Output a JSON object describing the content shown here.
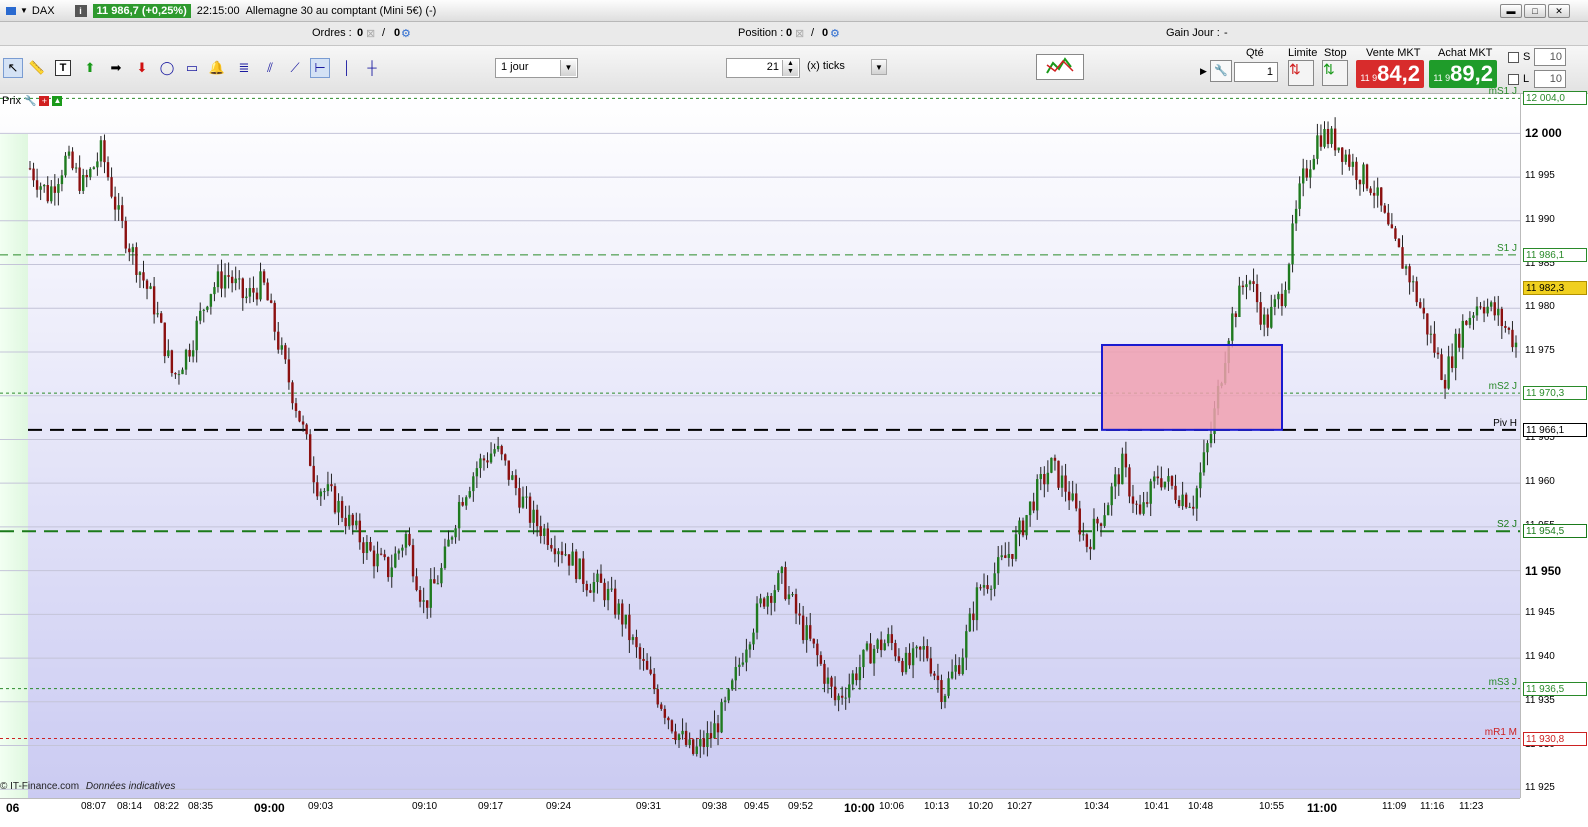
{
  "titlebar": {
    "symbol": "DAX",
    "info_icon": "i",
    "price_badge": "11 986,7 (+0,25%)",
    "time": "22:15:00",
    "instrument": "Allemagne 30 au comptant (Mini 5€) (-)"
  },
  "status": {
    "ordres_label": "Ordres :",
    "ordres_value": "0",
    "ordres_value2": "0",
    "position_label": "Position :",
    "position_value": "0",
    "position_value2": "0",
    "gain_label": "Gain Jour :",
    "gain_value": "-"
  },
  "toolbar": {
    "period": "1 jour",
    "ticks_value": "21",
    "ticks_unit": "(x) ticks"
  },
  "trade": {
    "qte_label": "Qté",
    "qte_value": "1",
    "limite_label": "Limite",
    "stop_label": "Stop",
    "vente_label": "Vente MKT",
    "vente_small": "11 9",
    "vente_big": "84,2",
    "achat_label": "Achat MKT",
    "achat_small": "11 9",
    "achat_big": "89,2",
    "s_label": "S",
    "s_value": "10",
    "l_label": "L",
    "l_value": "10"
  },
  "chart": {
    "header_label": "Prix",
    "credit": "© IT-Finance.com",
    "credit_note": "Données indicatives",
    "colors": {
      "up": "#1f7a1f",
      "down": "#8b1010",
      "support": "#1a7a1a",
      "pivot": "#000000",
      "resist": "#cc2222",
      "zone_fill": "#f0a0b0",
      "zone_stroke": "#1a1ad0"
    }
  },
  "chart_data": {
    "type": "candlestick",
    "y_ticks": [
      "12 000",
      "11 995",
      "11 990",
      "11 985",
      "11 980",
      "11 975",
      "11 970",
      "11 965",
      "11 960",
      "11 955",
      "11 950",
      "11 945",
      "11 940",
      "11 935",
      "11 930",
      "11 925"
    ],
    "ylim": [
      11924,
      12004.5
    ],
    "x_ticks": [
      "06",
      "08:07",
      "08:14",
      "08:22",
      "08:35",
      "09:00",
      "09:03",
      "09:10",
      "09:17",
      "09:24",
      "09:31",
      "09:38",
      "09:45",
      "09:52",
      "10:00",
      "10:06",
      "10:13",
      "10:20",
      "10:27",
      "10:34",
      "10:41",
      "10:48",
      "10:55",
      "11:00",
      "11:09",
      "11:16",
      "11:23"
    ],
    "levels": [
      {
        "name": "mS1 J",
        "value_label": "12 004,0",
        "value": 12004.0,
        "style": "dotted-green"
      },
      {
        "name": "S1 J",
        "value_label": "11 986,1",
        "value": 11986.1,
        "style": "dashed-green"
      },
      {
        "name": "mS2 J",
        "value_label": "11 970,3",
        "value": 11970.3,
        "style": "dotted-green"
      },
      {
        "name": "Piv H",
        "value_label": "11 966,1",
        "value": 11966.1,
        "style": "dashed-black"
      },
      {
        "name": "S2 J",
        "value_label": "11 954,5",
        "value": 11954.5,
        "style": "dashed-green-thick"
      },
      {
        "name": "mS3 J",
        "value_label": "11 936,5",
        "value": 11936.5,
        "style": "dotted-green"
      },
      {
        "name": "mR1 M",
        "value_label": "11 930,8",
        "value": 11930.8,
        "style": "dotted-red"
      }
    ],
    "last_price_label": "11 982,3",
    "last_price": 11982.3,
    "price_path": [
      11996,
      11993,
      11997,
      11994,
      11998,
      11990,
      11985,
      11980,
      11972,
      11976,
      11982,
      11984,
      11981,
      11983,
      11975,
      11968,
      11960,
      11958,
      11955,
      11952,
      11950,
      11954,
      11946,
      11950,
      11958,
      11962,
      11964,
      11960,
      11956,
      11954,
      11952,
      11949,
      11948,
      11945,
      11940,
      11936,
      11932,
      11929,
      11931,
      11935,
      11942,
      11947,
      11949,
      11944,
      11940,
      11935,
      11938,
      11941,
      11942,
      11939,
      11941,
      11936,
      11940,
      11948,
      11950,
      11953,
      11958,
      11962,
      11959,
      11953,
      11957,
      11962,
      11956,
      11961,
      11959,
      11958,
      11966,
      11978,
      11984,
      11978,
      11982,
      11994,
      12000,
      11999,
      11996,
      11994,
      11988,
      11984,
      11978,
      11972,
      11978,
      11981,
      11979,
      11976
    ]
  }
}
